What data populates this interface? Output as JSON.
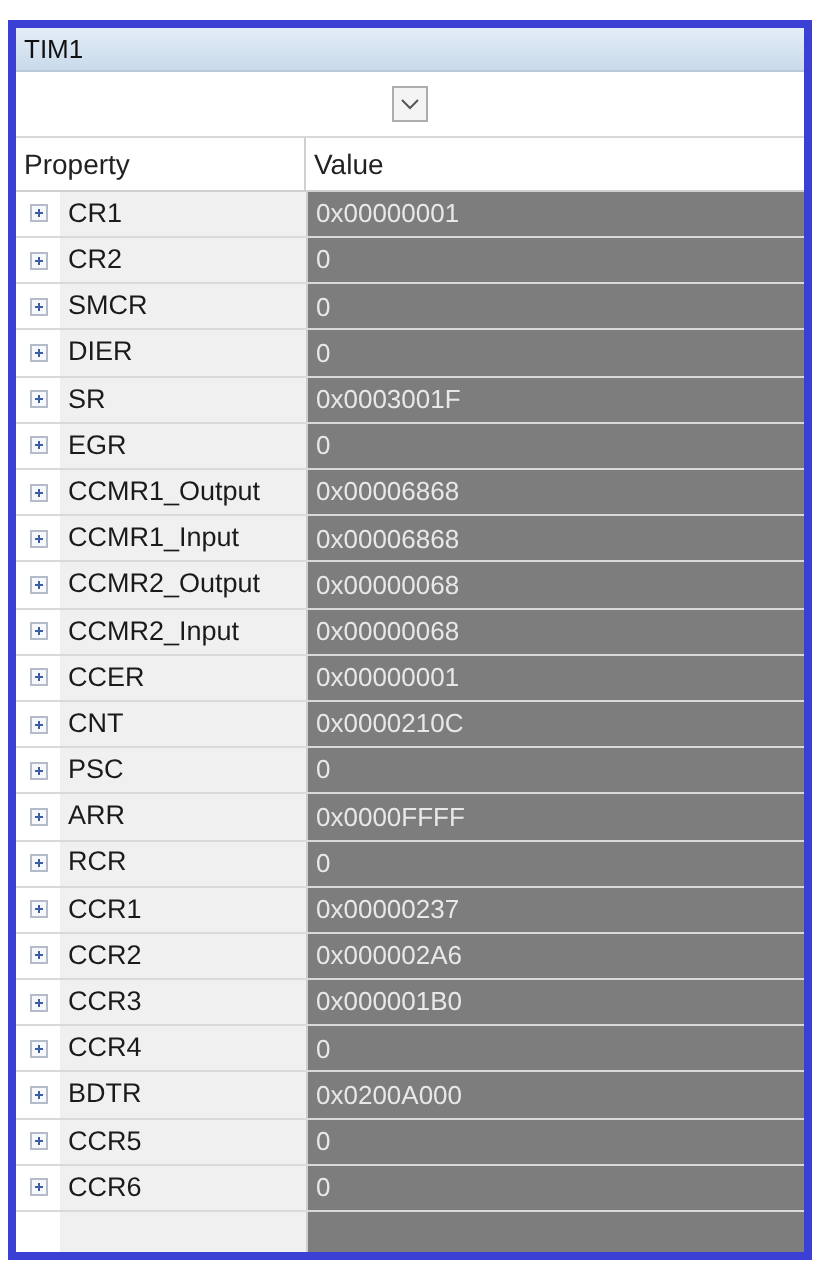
{
  "panel": {
    "title": "TIM1"
  },
  "table": {
    "columns": [
      "Property",
      "Value"
    ],
    "rows": [
      {
        "name": "CR1",
        "value": "0x00000001",
        "expanded": false
      },
      {
        "name": "CR2",
        "value": "0",
        "expanded": false
      },
      {
        "name": "SMCR",
        "value": "0",
        "expanded": false
      },
      {
        "name": "DIER",
        "value": "0",
        "expanded": false
      },
      {
        "name": "SR",
        "value": "0x0003001F",
        "expanded": false
      },
      {
        "name": "EGR",
        "value": "0",
        "expanded": false
      },
      {
        "name": "CCMR1_Output",
        "value": "0x00006868",
        "expanded": false
      },
      {
        "name": "CCMR1_Input",
        "value": "0x00006868",
        "expanded": false
      },
      {
        "name": "CCMR2_Output",
        "value": "0x00000068",
        "expanded": false
      },
      {
        "name": "CCMR2_Input",
        "value": "0x00000068",
        "expanded": false
      },
      {
        "name": "CCER",
        "value": "0x00000001",
        "expanded": false
      },
      {
        "name": "CNT",
        "value": "0x0000210C",
        "expanded": false
      },
      {
        "name": "PSC",
        "value": "0",
        "expanded": false
      },
      {
        "name": "ARR",
        "value": "0x0000FFFF",
        "expanded": false
      },
      {
        "name": "RCR",
        "value": "0",
        "expanded": false
      },
      {
        "name": "CCR1",
        "value": "0x00000237",
        "expanded": false
      },
      {
        "name": "CCR2",
        "value": "0x000002A6",
        "expanded": false
      },
      {
        "name": "CCR3",
        "value": "0x000001B0",
        "expanded": false
      },
      {
        "name": "CCR4",
        "value": "0",
        "expanded": false
      },
      {
        "name": "BDTR",
        "value": "0x0200A000",
        "expanded": false
      },
      {
        "name": "CCR5",
        "value": "0",
        "expanded": false
      },
      {
        "name": "CCR6",
        "value": "0",
        "expanded": false
      }
    ]
  }
}
